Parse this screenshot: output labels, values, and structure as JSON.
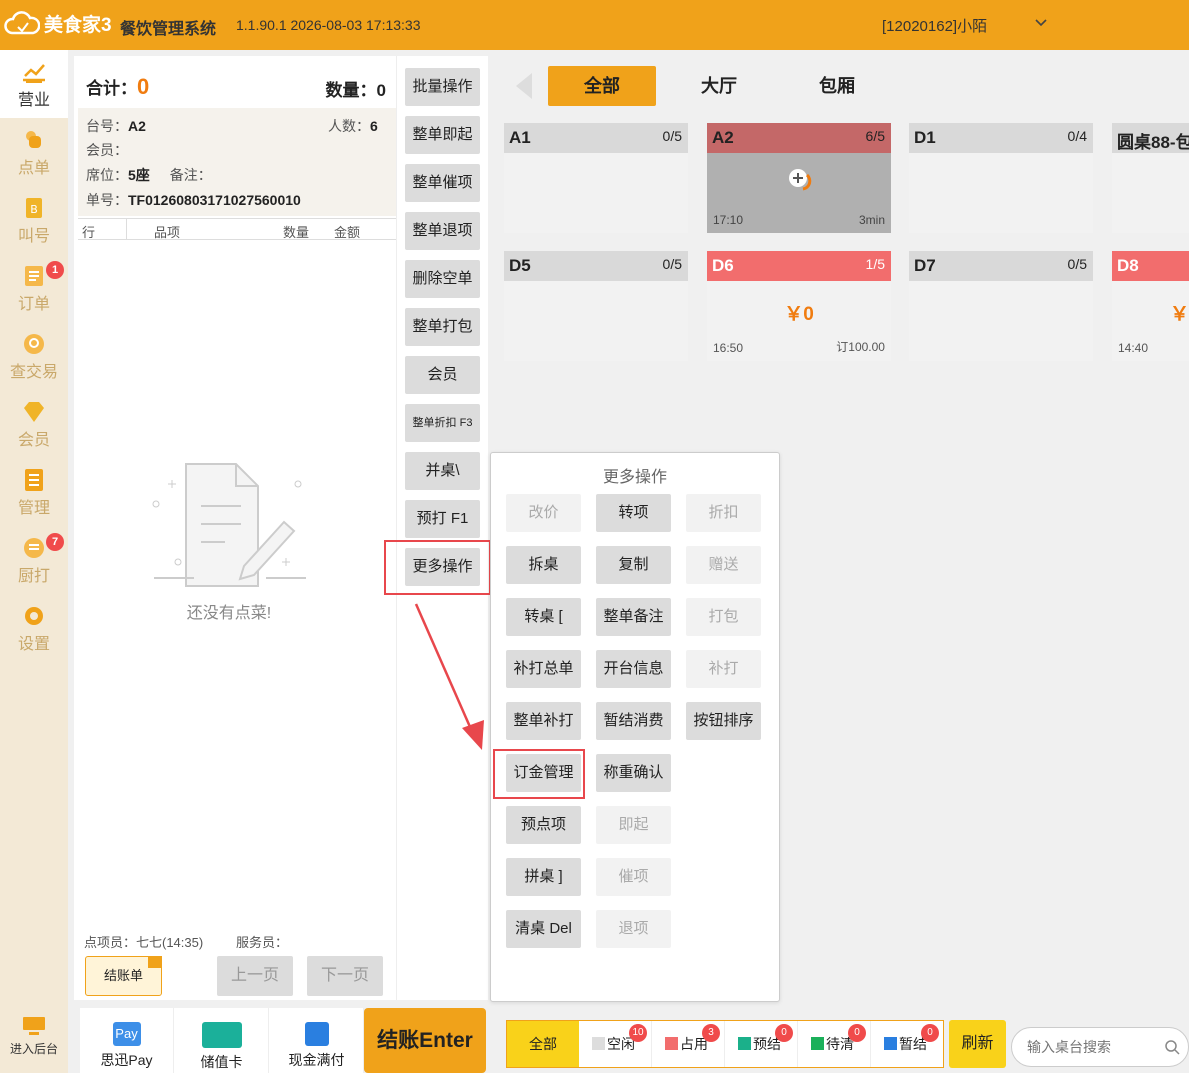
{
  "header": {
    "app_name": "美食家3",
    "system_title": "餐饮管理系统",
    "version": "1.1.90.1 2026-08-03 17:13:33",
    "user": "[12020162]小陌"
  },
  "nav": {
    "items": [
      {
        "label": "营业"
      },
      {
        "label": "点单"
      },
      {
        "label": "叫号"
      },
      {
        "label": "订单",
        "badge": "1"
      },
      {
        "label": "查交易"
      },
      {
        "label": "会员"
      },
      {
        "label": "管理"
      },
      {
        "label": "厨打",
        "badge": "7"
      },
      {
        "label": "设置"
      }
    ],
    "backend_label": "进入后台"
  },
  "order": {
    "total_label": "合计：",
    "total_value": "0",
    "qty_label": "数量：",
    "qty_value": "0",
    "table_label": "台号：",
    "table_value": "A2",
    "guests_label": "人数：",
    "guests_value": "6",
    "member_label": "会员：",
    "seat_label": "席位：",
    "seat_value": "5座",
    "note_label": "备注：",
    "order_no_label": "单号：",
    "order_no_value": "TF01260803171027560010",
    "columns": [
      "行",
      "品项",
      "数量",
      "金额"
    ],
    "empty_text": "还没有点菜!",
    "staff_label": "点项员：七七(14:35)",
    "waiter_label": "服务员：",
    "bill_button": "结账单",
    "prev_page": "上一页",
    "next_page": "下一页"
  },
  "side_actions": [
    "批量操作",
    "整单即起",
    "整单催项",
    "整单退项",
    "删除空单",
    "整单打包",
    "会员",
    "整单折扣 F3",
    "并桌\\",
    "预打 F1",
    "更多操作"
  ],
  "payments": [
    {
      "label": "思迅Pay",
      "icon": "pay-icon"
    },
    {
      "label": "储值卡",
      "icon": "card-icon"
    },
    {
      "label": "现金满付",
      "icon": "cash-icon"
    }
  ],
  "checkout_label": "结账Enter",
  "area_tabs": [
    "全部",
    "大厅",
    "包厢"
  ],
  "tables": [
    {
      "name": "A1",
      "cap": "0/5",
      "state": "free"
    },
    {
      "name": "A2",
      "cap": "6/5",
      "state": "busy",
      "time": "17:10",
      "right": "3min"
    },
    {
      "name": "D1",
      "cap": "0/4",
      "state": "free"
    },
    {
      "name": "圆桌88-包",
      "cap": "",
      "state": "free"
    },
    {
      "name": "D5",
      "cap": "0/5",
      "state": "free"
    },
    {
      "name": "D6",
      "cap": "1/5",
      "state": "red",
      "amount": "￥0",
      "time": "16:50",
      "right": "订100.00"
    },
    {
      "name": "D7",
      "cap": "0/5",
      "state": "free"
    },
    {
      "name": "D8",
      "cap": "",
      "state": "red",
      "amount": "￥",
      "time": "14:40"
    }
  ],
  "more_ops": {
    "title": "更多操作",
    "buttons": [
      {
        "label": "改价",
        "enabled": false
      },
      {
        "label": "转项",
        "enabled": true
      },
      {
        "label": "折扣",
        "enabled": false
      },
      {
        "label": "拆桌",
        "enabled": true
      },
      {
        "label": "复制",
        "enabled": true
      },
      {
        "label": "赠送",
        "enabled": false
      },
      {
        "label": "转桌 [",
        "enabled": true
      },
      {
        "label": "整单备注",
        "enabled": true
      },
      {
        "label": "打包",
        "enabled": false
      },
      {
        "label": "补打总单",
        "enabled": true
      },
      {
        "label": "开台信息",
        "enabled": true
      },
      {
        "label": "补打",
        "enabled": false
      },
      {
        "label": "整单补打",
        "enabled": true
      },
      {
        "label": "暂结消费",
        "enabled": true
      },
      {
        "label": "按钮排序",
        "enabled": true
      },
      {
        "label": "订金管理",
        "enabled": true
      },
      {
        "label": "称重确认",
        "enabled": true
      },
      {
        "label": "预点项",
        "enabled": true
      },
      {
        "label": "即起",
        "enabled": false
      },
      {
        "label": "拼桌 ]",
        "enabled": true
      },
      {
        "label": "催项",
        "enabled": false
      },
      {
        "label": "清桌 Del",
        "enabled": true
      },
      {
        "label": "退项",
        "enabled": false
      }
    ]
  },
  "status_filter": {
    "all": "全部",
    "items": [
      {
        "label": "空闲",
        "count": "10",
        "color": "#dddddd"
      },
      {
        "label": "占用",
        "count": "3",
        "color": "#f26d6d"
      },
      {
        "label": "预结",
        "count": "0",
        "color": "#1bb08a"
      },
      {
        "label": "待清",
        "count": "0",
        "color": "#1bb05a"
      },
      {
        "label": "暂结",
        "count": "0",
        "color": "#2a7fe0"
      }
    ]
  },
  "refresh_label": "刷新",
  "search": {
    "placeholder": "输入桌台搜索"
  },
  "colors": {
    "brand": "#f0a21a",
    "accent_orange": "#f07c10",
    "highlight_red": "#e8474c"
  }
}
